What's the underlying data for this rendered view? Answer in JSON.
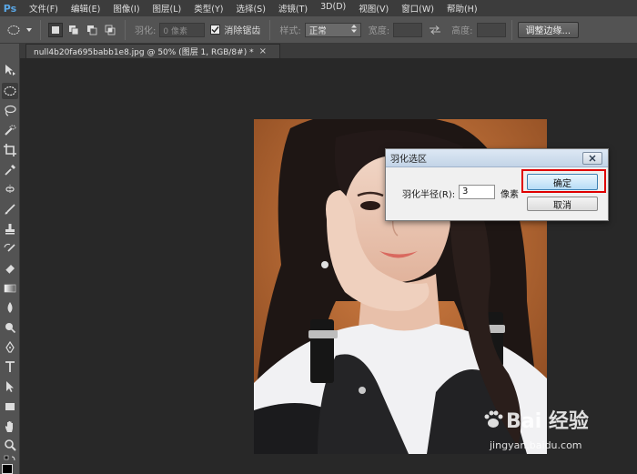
{
  "app": {
    "logo": "Ps"
  },
  "menu": [
    "文件(F)",
    "编辑(E)",
    "图像(I)",
    "图层(L)",
    "类型(Y)",
    "选择(S)",
    "滤镜(T)",
    "3D(D)",
    "视图(V)",
    "窗口(W)",
    "帮助(H)"
  ],
  "options_bar": {
    "feather_label": "羽化:",
    "feather_value": "0 像素",
    "anti_alias_label": "消除锯齿",
    "style_label": "样式:",
    "style_value": "正常",
    "width_label": "宽度:",
    "height_label": "高度:",
    "refine_edge_button": "调整边缘..."
  },
  "document": {
    "tab_title": "null4b20fa695babb1e8.jpg @ 50% (图层 1, RGB/8#) *",
    "close": "×"
  },
  "dialog": {
    "title": "羽化选区",
    "radius_label": "羽化半径(R):",
    "radius_value": "3",
    "unit": "像素",
    "ok_button": "确定",
    "cancel_button": "取消"
  },
  "watermark": {
    "brand": "Bai 经验",
    "url": "jingyan.baidu.com"
  },
  "colors": {
    "accent_highlight": "#e00000",
    "photo_background": "#c7773e"
  }
}
